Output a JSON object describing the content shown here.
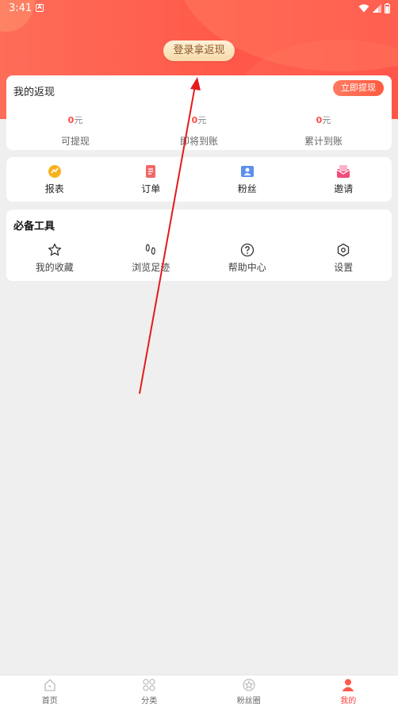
{
  "status": {
    "time": "3:41",
    "notif": "A"
  },
  "header": {
    "login_label": "登录拿返现"
  },
  "rebate": {
    "title": "我的返现",
    "withdraw_label": "立即提现",
    "unit": "元",
    "stats": [
      {
        "amount": "0",
        "label": "可提现"
      },
      {
        "amount": "0",
        "label": "即将到账"
      },
      {
        "amount": "0",
        "label": "累计到账"
      }
    ]
  },
  "shortcuts": [
    {
      "label": "报表",
      "icon": "report-icon",
      "color": "#f7b21e"
    },
    {
      "label": "订单",
      "icon": "order-icon",
      "color": "#f26767"
    },
    {
      "label": "粉丝",
      "icon": "fans-icon",
      "color": "#5b8ff0"
    },
    {
      "label": "邀请",
      "icon": "invite-icon",
      "color": "#f04c7a"
    }
  ],
  "tools": {
    "title": "必备工具",
    "items": [
      {
        "label": "我的收藏",
        "icon": "star-icon"
      },
      {
        "label": "浏览足迹",
        "icon": "footprint-icon"
      },
      {
        "label": "帮助中心",
        "icon": "help-icon"
      },
      {
        "label": "设置",
        "icon": "settings-icon"
      }
    ]
  },
  "nav": [
    {
      "label": "首页",
      "icon": "home-icon",
      "active": false
    },
    {
      "label": "分类",
      "icon": "category-icon",
      "active": false
    },
    {
      "label": "粉丝圈",
      "icon": "fans-circle-icon",
      "active": false
    },
    {
      "label": "我的",
      "icon": "profile-icon",
      "active": true
    }
  ],
  "colors": {
    "accent": "#ff4a45",
    "active_tab": "#ff3b3b"
  }
}
